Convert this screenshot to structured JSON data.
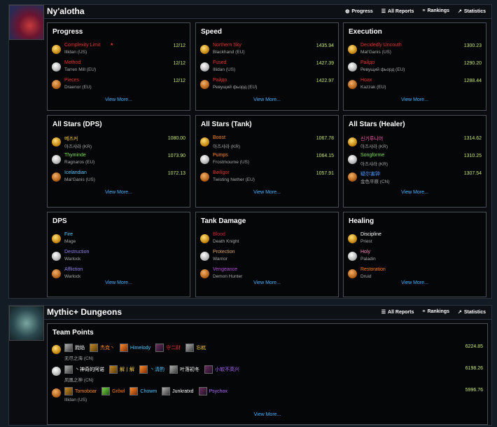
{
  "raid": {
    "title": "Ny'alotha",
    "nav": {
      "progress": "Progress",
      "all_reports": "All Reports",
      "rankings": "Rankings",
      "statistics": "Statistics"
    },
    "panels": [
      {
        "title": "Progress",
        "more": "View More...",
        "rows": [
          {
            "name": "Complexity Limit",
            "sub": "Illidan (US)",
            "value": "12/12",
            "medal": "gold",
            "cls": "c-red",
            "star": true
          },
          {
            "name": "Method",
            "sub": "Tarren Mill (EU)",
            "value": "12/12",
            "medal": "silver",
            "cls": "c-red"
          },
          {
            "name": "Pieces",
            "sub": "Draenor (EU)",
            "value": "12/12",
            "medal": "bronze",
            "cls": "c-red"
          }
        ]
      },
      {
        "title": "Speed",
        "more": "View More...",
        "rows": [
          {
            "name": "Northern Sky",
            "sub": "Blackhand (EU)",
            "value": "1435.94",
            "medal": "gold",
            "cls": "c-red"
          },
          {
            "name": "Fused",
            "sub": "Illidan (US)",
            "value": "1427.39",
            "medal": "silver",
            "cls": "c-red"
          },
          {
            "name": "Райдо",
            "sub": "Ревущий фьорд (EU)",
            "value": "1422.97",
            "medal": "bronze",
            "cls": "c-red"
          }
        ]
      },
      {
        "title": "Execution",
        "more": "View More...",
        "rows": [
          {
            "name": "Decidedly Uncouth",
            "sub": "Mal'Ganis (US)",
            "value": "1300.23",
            "medal": "gold",
            "cls": "c-red"
          },
          {
            "name": "Райдо",
            "sub": "Ревущий фьорд (EU)",
            "value": "1290.20",
            "medal": "silver",
            "cls": "c-red"
          },
          {
            "name": "Hoax",
            "sub": "Kazzak (EU)",
            "value": "1288.44",
            "medal": "bronze",
            "cls": "c-red"
          }
        ]
      },
      {
        "title": "All Stars (DPS)",
        "more": "View More...",
        "rows": [
          {
            "name": "메즈커",
            "sub": "아즈샤라 (KR)",
            "value": "1080.00",
            "medal": "gold",
            "cls": "c-yellow"
          },
          {
            "name": "Thyminde",
            "sub": "Ragnaros (EU)",
            "value": "1073.90",
            "medal": "silver",
            "cls": "c-green"
          },
          {
            "name": "Icelandian",
            "sub": "Mal'Ganis (US)",
            "value": "1072.13",
            "medal": "bronze",
            "cls": "c-mage"
          }
        ]
      },
      {
        "title": "All Stars (Tank)",
        "more": "View More...",
        "rows": [
          {
            "name": "Boost",
            "sub": "아즈샤라 (KR)",
            "value": "1067.78",
            "medal": "gold",
            "cls": "c-orange"
          },
          {
            "name": "Pumps",
            "sub": "Frostmourne (US)",
            "value": "1064.15",
            "medal": "silver",
            "cls": "c-orange"
          },
          {
            "name": "Bøiligor",
            "sub": "Twisting Nether (EU)",
            "value": "1057.91",
            "medal": "bronze",
            "cls": "c-red"
          }
        ]
      },
      {
        "title": "All Stars (Healer)",
        "more": "View More...",
        "rows": [
          {
            "name": "신기루니어",
            "sub": "아즈샤라 (KR)",
            "value": "1314.62",
            "medal": "gold",
            "cls": "c-pink"
          },
          {
            "name": "Songforme",
            "sub": "아즈샤라 (KR)",
            "value": "1310.25",
            "medal": "silver",
            "cls": "c-green"
          },
          {
            "name": "疑尔害钟",
            "sub": "金色平原 (CN)",
            "value": "1307.54",
            "medal": "bronze",
            "cls": "c-blue"
          }
        ]
      },
      {
        "title": "DPS",
        "more": "View More...",
        "rows": [
          {
            "name": "Fire",
            "sub": "Mage",
            "value": "",
            "medal": "gold",
            "cls": "c-mage"
          },
          {
            "name": "Destruction",
            "sub": "Warlock",
            "value": "",
            "medal": "silver",
            "cls": "c-lock"
          },
          {
            "name": "Affliction",
            "sub": "Warlock",
            "value": "",
            "medal": "bronze",
            "cls": "c-lock"
          }
        ]
      },
      {
        "title": "Tank Damage",
        "more": "View More...",
        "rows": [
          {
            "name": "Blood",
            "sub": "Death Knight",
            "value": "",
            "medal": "gold",
            "cls": "c-dk"
          },
          {
            "name": "Protection",
            "sub": "Warrior",
            "value": "",
            "medal": "silver",
            "cls": "c-warr"
          },
          {
            "name": "Vengeance",
            "sub": "Demon Hunter",
            "value": "",
            "medal": "bronze",
            "cls": "c-dh"
          }
        ]
      },
      {
        "title": "Healing",
        "more": "View More...",
        "rows": [
          {
            "name": "Discipline",
            "sub": "Priest",
            "value": "",
            "medal": "gold",
            "cls": "c-priest"
          },
          {
            "name": "Holy",
            "sub": "Paladin",
            "value": "",
            "medal": "silver",
            "cls": "c-pal"
          },
          {
            "name": "Restoration",
            "sub": "Druid",
            "value": "",
            "medal": "bronze",
            "cls": "c-druid"
          }
        ]
      }
    ]
  },
  "dungeons": {
    "title": "Mythic+ Dungeons",
    "nav": {
      "all_reports": "All Reports",
      "rankings": "Rankings",
      "statistics": "Statistics"
    },
    "team_points": {
      "title": "Team Points",
      "more": "View More...",
      "rows": [
        {
          "medal": "gold",
          "realm": "无尽之海 (CN)",
          "value": "6224.85",
          "members": [
            {
              "name": "戮焰",
              "cls": "c-priest",
              "icon": "d"
            },
            {
              "name": "杰克丶",
              "cls": "c-orange",
              "icon": "a"
            },
            {
              "name": "Himelody",
              "cls": "c-mon",
              "icon": "e"
            },
            {
              "name": "守二财",
              "cls": "c-red",
              "icon": "c"
            },
            {
              "name": "忘杌",
              "cls": "c-yellow",
              "icon": "d"
            }
          ]
        },
        {
          "medal": "silver",
          "realm": "凤凰之神 (CN)",
          "value": "6198.26",
          "members": [
            {
              "name": "丶神奇的阿诺",
              "cls": "c-priest",
              "icon": "d"
            },
            {
              "name": "解丨解",
              "cls": "c-yellow",
              "icon": "a"
            },
            {
              "name": "丶清酌",
              "cls": "c-mon",
              "icon": "e"
            },
            {
              "name": "叶落初冬",
              "cls": "c-priest",
              "icon": "d"
            },
            {
              "name": "小软不高兴",
              "cls": "c-purple",
              "icon": "c"
            }
          ]
        },
        {
          "medal": "bronze",
          "realm": "Illidan (US)",
          "value": "5996.76",
          "members": [
            {
              "name": "Tomoboar",
              "cls": "c-orange",
              "icon": "a"
            },
            {
              "name": "Grõwl",
              "cls": "c-druid",
              "icon": "b"
            },
            {
              "name": "Chowm",
              "cls": "c-mon",
              "icon": "e"
            },
            {
              "name": "Junkratxd",
              "cls": "c-priest",
              "icon": "d"
            },
            {
              "name": "Psychox",
              "cls": "c-purple",
              "icon": "c"
            }
          ]
        }
      ]
    }
  }
}
